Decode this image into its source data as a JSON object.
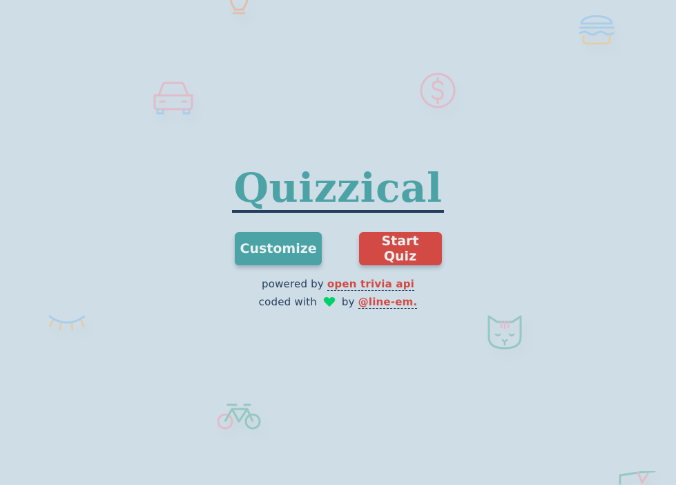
{
  "app": {
    "title": "Quizzical"
  },
  "buttons": {
    "customize_label": "Customize",
    "start_label": "Start Quiz"
  },
  "credits": {
    "powered_prefix": "powered by ",
    "powered_link": "open trivia api",
    "coded_prefix": "coded with ",
    "coded_by": " by ",
    "author_link": "@line-em."
  },
  "colors": {
    "background": "#cfdde6",
    "brand_teal": "#4ba3a6",
    "brand_red": "#d24a43",
    "ink": "#233d5e",
    "heart": "#00d06a"
  },
  "decorations": [
    "lightbulb-icon",
    "hamburger-icon",
    "car-icon",
    "dollar-coin-icon",
    "closed-eye-icon",
    "cat-icon",
    "bicycle-icon",
    "flag-icon"
  ]
}
